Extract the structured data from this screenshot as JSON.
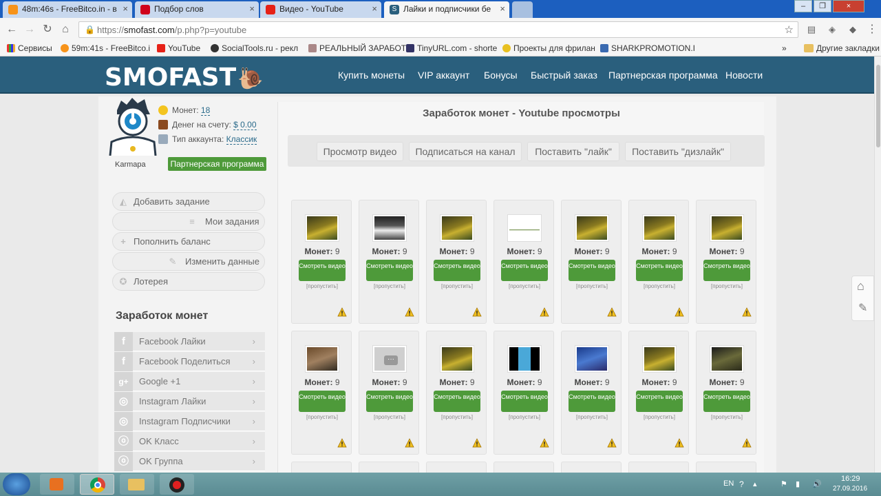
{
  "browser": {
    "tabs": [
      {
        "label": "48m:46s - FreeBitco.in - в",
        "favicon_color": "#f7931a"
      },
      {
        "label": "Подбор слов",
        "favicon_color": "#d0021b"
      },
      {
        "label": "Видео - YouTube",
        "favicon_color": "#e62117"
      },
      {
        "label": "Лайки и подписчики бе",
        "favicon_color": "#2a5f7d"
      }
    ],
    "url_prefix": "https://",
    "url_host": "smofast.com",
    "url_path": "/p.php?p=youtube",
    "bookmarks": [
      "Сервисы",
      "59m:41s - FreeBitco.i",
      "YouTube",
      "SocialTools.ru - рекл",
      "РЕАЛЬНЫЙ ЗАРАБОТ",
      "TinyURL.com - shorte",
      "Проекты для фрилан",
      "SHARKPROMOTION.I"
    ],
    "bookmarks_more": "»",
    "other_bookmarks": "Другие закладки"
  },
  "site": {
    "logo": "SMOFAST",
    "nav": [
      "Купить монеты",
      "VIP аккаунт",
      "Бонусы",
      "Быстрый заказ",
      "Партнерская программа",
      "Новости"
    ],
    "accent": "#2a5f7d",
    "green": "#4e9a3a"
  },
  "sidebar": {
    "coins_label": "Монет:",
    "coins_value": "18",
    "money_label": "Денег на счету:",
    "money_value": "$ 0.00",
    "account_label": "Тип аккаунта:",
    "account_value": "Классик",
    "username": "Karmapa",
    "partner_button": "Партнерская программа",
    "actions": [
      "Добавить задание",
      "Мои задания",
      "Пополнить баланс",
      "Изменить данные",
      "Лотерея"
    ],
    "earn_title": "Заработок монет",
    "earn_items": [
      {
        "label": "Facebook Лайки",
        "icon": "f"
      },
      {
        "label": "Facebook Поделиться",
        "icon": "f"
      },
      {
        "label": "Google +1",
        "icon": "g+"
      },
      {
        "label": "Instagram Лайки",
        "icon": "ig"
      },
      {
        "label": "Instagram Подписчики",
        "icon": "ig"
      },
      {
        "label": "OK Класс",
        "icon": "ok"
      },
      {
        "label": "OK Группа",
        "icon": "ok"
      }
    ],
    "chevron": "›"
  },
  "main": {
    "title": "Заработок монет - Youtube просмотры",
    "tabs": [
      "Просмотр видео",
      "Подписаться на канал",
      "Поставить \"лайк\"",
      "Поставить \"дизлайк\""
    ],
    "coins_label": "Монет:",
    "coins_value": "9",
    "watch_label": "Смотреть видео",
    "skip_label": "[пропустить]",
    "rows": [
      [
        "game",
        "person",
        "game",
        "white",
        "game",
        "game",
        "game"
      ],
      [
        "street",
        "placeholder",
        "game",
        "screen",
        "blue",
        "game",
        "room"
      ]
    ]
  },
  "taskbar": {
    "lang": "EN",
    "time": "16:29",
    "date": "27.09.2016"
  }
}
